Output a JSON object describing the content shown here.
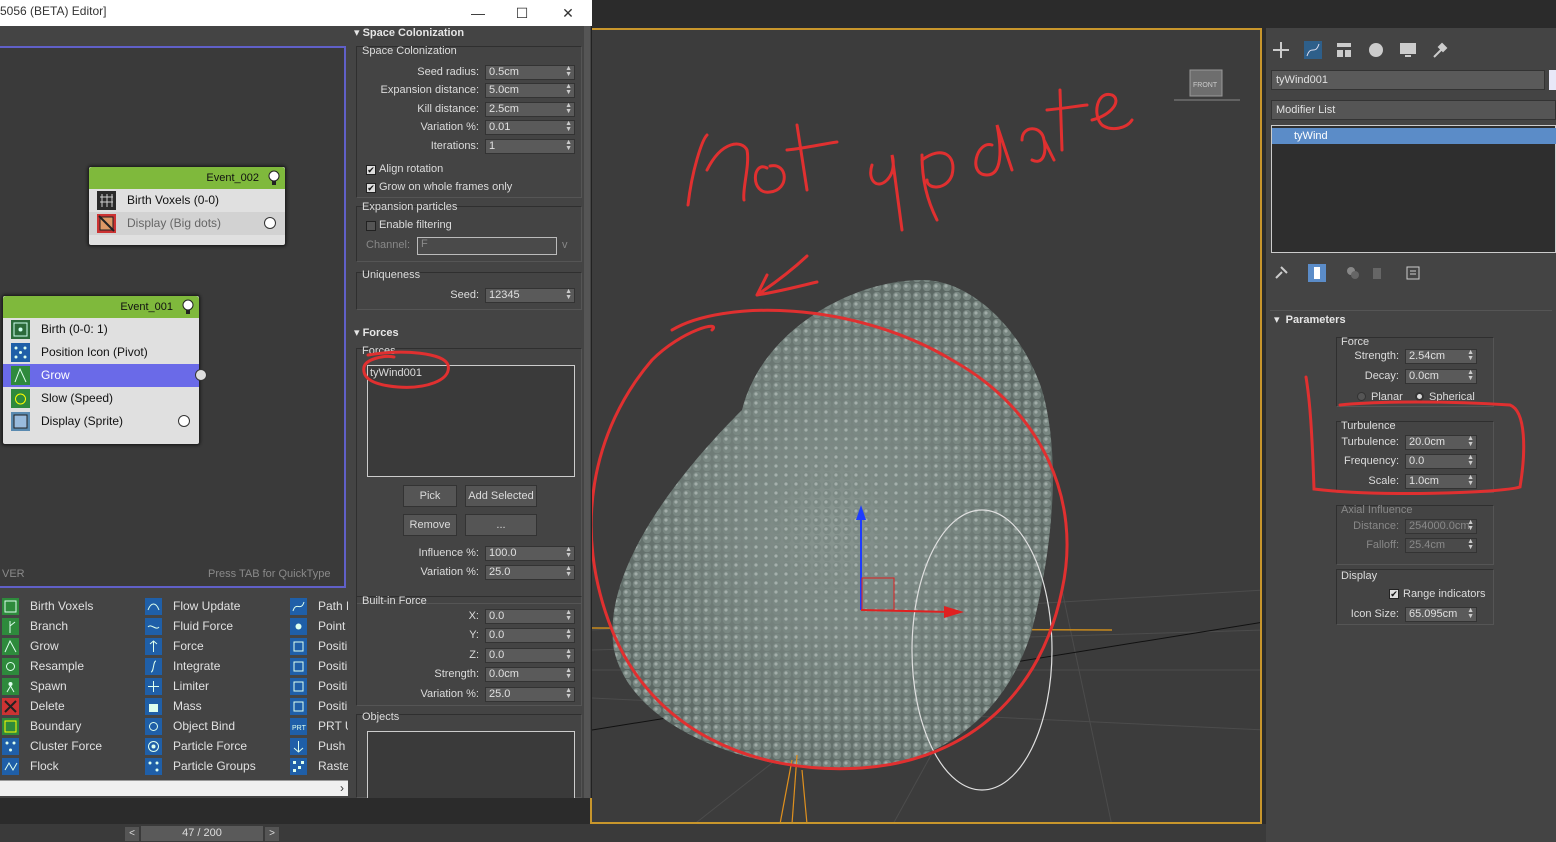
{
  "window": {
    "title": "5056 (BETA) Editor]",
    "minimize": "—",
    "maximize": "☐",
    "close": "✕"
  },
  "graph": {
    "left_label": "VER",
    "hint": "Press TAB for QuickType",
    "events": [
      {
        "title": "Event_002",
        "ops": [
          {
            "label": "Birth Voxels (0-0)",
            "icon": "birth-voxels-icon"
          },
          {
            "label": "Display (Big dots)",
            "icon": "display-icon"
          }
        ]
      },
      {
        "title": "Event_001",
        "ops": [
          {
            "label": "Birth (0-0: 1)",
            "icon": "birth-icon"
          },
          {
            "label": "Position Icon (Pivot)",
            "icon": "position-icon"
          },
          {
            "label": "Grow",
            "icon": "grow-icon"
          },
          {
            "label": "Slow (Speed)",
            "icon": "slow-icon"
          },
          {
            "label": "Display (Sprite)",
            "icon": "display-icon"
          }
        ]
      }
    ]
  },
  "depot": {
    "col1": [
      "Birth Voxels",
      "Branch",
      "Grow",
      "Resample",
      "Spawn",
      "Delete",
      "Boundary",
      "Cluster Force",
      "Flock"
    ],
    "col2": [
      "Flow Update",
      "Fluid Force",
      "Force",
      "Integrate",
      "Limiter",
      "Mass",
      "Object Bind",
      "Particle Force",
      "Particle Groups"
    ],
    "col3": [
      "Path F",
      "Point",
      "Positi",
      "Positi",
      "Positi",
      "Positi",
      "PRT U",
      "Push",
      "Raster"
    ]
  },
  "params": {
    "space_colonization": {
      "rollout": "Space Colonization",
      "group": "Space Colonization",
      "seed_radius_label": "Seed radius:",
      "seed_radius": "0.5cm",
      "expansion_distance_label": "Expansion distance:",
      "expansion_distance": "5.0cm",
      "kill_distance_label": "Kill distance:",
      "kill_distance": "2.5cm",
      "variation_label": "Variation %:",
      "variation": "0.01",
      "iterations_label": "Iterations:",
      "iterations": "1",
      "align_rotation": "Align rotation",
      "grow_whole_frames": "Grow on whole frames only",
      "expansion_particles": "Expansion particles",
      "enable_filtering": "Enable filtering",
      "channel_label": "Channel:",
      "channel_value": "F",
      "uniqueness": "Uniqueness",
      "seed_label": "Seed:",
      "seed": "12345"
    },
    "forces": {
      "rollout": "Forces",
      "group": "Forces",
      "items": [
        "tyWind001"
      ],
      "pick": "Pick",
      "add_selected": "Add Selected",
      "remove": "Remove",
      "more": "...",
      "influence_label": "Influence %:",
      "influence": "100.0",
      "variation_label": "Variation %:",
      "variation": "25.0",
      "builtin": "Built-in Force",
      "x_label": "X:",
      "x": "0.0",
      "y_label": "Y:",
      "y": "0.0",
      "z_label": "Z:",
      "z": "0.0",
      "strength_label": "Strength:",
      "strength": "0.0cm",
      "bvariation_label": "Variation %:",
      "bvariation": "25.0",
      "objects": "Objects"
    }
  },
  "command_panel": {
    "object_name": "tyWind001",
    "modifier_list": "Modifier List",
    "stack": [
      "tyWind"
    ],
    "parameters": "Parameters",
    "force_group": "Force",
    "strength_label": "Strength:",
    "strength": "2.54cm",
    "decay_label": "Decay:",
    "decay": "0.0cm",
    "planar": "Planar",
    "spherical": "Spherical",
    "turbulence_group": "Turbulence",
    "turbulence_label": "Turbulence:",
    "turbulence": "20.0cm",
    "frequency_label": "Frequency:",
    "frequency": "0.0",
    "scale_label": "Scale:",
    "scale": "1.0cm",
    "axial_group": "Axial Influence",
    "distance_label": "Distance:",
    "distance": "254000.0cm",
    "falloff_label": "Falloff:",
    "falloff": "25.4cm",
    "display_group": "Display",
    "range_indicators": "Range indicators",
    "icon_size_label": "Icon Size:",
    "icon_size": "65.095cm"
  },
  "viewport": {
    "viewcube_label": "FRONT",
    "annotation": "not update"
  },
  "timeline": {
    "frame": "47 / 200",
    "prev": "<",
    "next": ">"
  },
  "colors": {
    "event_header": "#7fb93c",
    "selected_op": "#6a6ae8",
    "annotation": "#e03030",
    "viewport_border": "#c8962c"
  }
}
